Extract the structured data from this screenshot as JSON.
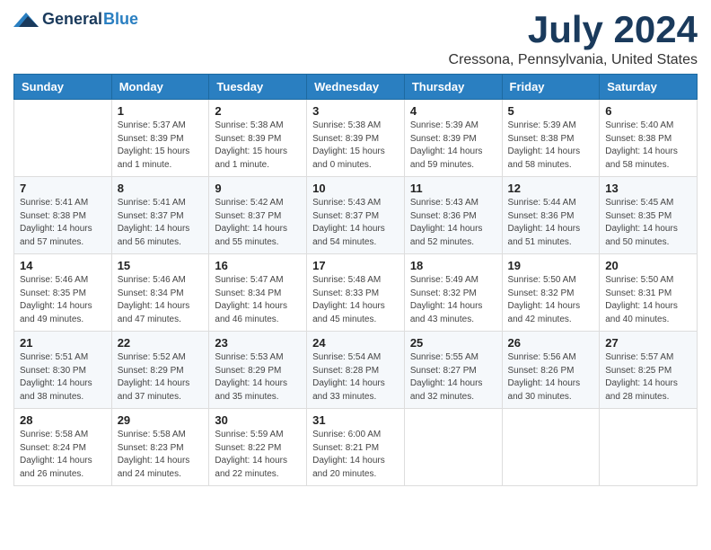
{
  "header": {
    "logo_general": "General",
    "logo_blue": "Blue",
    "month_title": "July 2024",
    "location": "Cressona, Pennsylvania, United States"
  },
  "weekdays": [
    "Sunday",
    "Monday",
    "Tuesday",
    "Wednesday",
    "Thursday",
    "Friday",
    "Saturday"
  ],
  "weeks": [
    [
      {
        "day": "",
        "info": ""
      },
      {
        "day": "1",
        "info": "Sunrise: 5:37 AM\nSunset: 8:39 PM\nDaylight: 15 hours\nand 1 minute."
      },
      {
        "day": "2",
        "info": "Sunrise: 5:38 AM\nSunset: 8:39 PM\nDaylight: 15 hours\nand 1 minute."
      },
      {
        "day": "3",
        "info": "Sunrise: 5:38 AM\nSunset: 8:39 PM\nDaylight: 15 hours\nand 0 minutes."
      },
      {
        "day": "4",
        "info": "Sunrise: 5:39 AM\nSunset: 8:39 PM\nDaylight: 14 hours\nand 59 minutes."
      },
      {
        "day": "5",
        "info": "Sunrise: 5:39 AM\nSunset: 8:38 PM\nDaylight: 14 hours\nand 58 minutes."
      },
      {
        "day": "6",
        "info": "Sunrise: 5:40 AM\nSunset: 8:38 PM\nDaylight: 14 hours\nand 58 minutes."
      }
    ],
    [
      {
        "day": "7",
        "info": "Sunrise: 5:41 AM\nSunset: 8:38 PM\nDaylight: 14 hours\nand 57 minutes."
      },
      {
        "day": "8",
        "info": "Sunrise: 5:41 AM\nSunset: 8:37 PM\nDaylight: 14 hours\nand 56 minutes."
      },
      {
        "day": "9",
        "info": "Sunrise: 5:42 AM\nSunset: 8:37 PM\nDaylight: 14 hours\nand 55 minutes."
      },
      {
        "day": "10",
        "info": "Sunrise: 5:43 AM\nSunset: 8:37 PM\nDaylight: 14 hours\nand 54 minutes."
      },
      {
        "day": "11",
        "info": "Sunrise: 5:43 AM\nSunset: 8:36 PM\nDaylight: 14 hours\nand 52 minutes."
      },
      {
        "day": "12",
        "info": "Sunrise: 5:44 AM\nSunset: 8:36 PM\nDaylight: 14 hours\nand 51 minutes."
      },
      {
        "day": "13",
        "info": "Sunrise: 5:45 AM\nSunset: 8:35 PM\nDaylight: 14 hours\nand 50 minutes."
      }
    ],
    [
      {
        "day": "14",
        "info": "Sunrise: 5:46 AM\nSunset: 8:35 PM\nDaylight: 14 hours\nand 49 minutes."
      },
      {
        "day": "15",
        "info": "Sunrise: 5:46 AM\nSunset: 8:34 PM\nDaylight: 14 hours\nand 47 minutes."
      },
      {
        "day": "16",
        "info": "Sunrise: 5:47 AM\nSunset: 8:34 PM\nDaylight: 14 hours\nand 46 minutes."
      },
      {
        "day": "17",
        "info": "Sunrise: 5:48 AM\nSunset: 8:33 PM\nDaylight: 14 hours\nand 45 minutes."
      },
      {
        "day": "18",
        "info": "Sunrise: 5:49 AM\nSunset: 8:32 PM\nDaylight: 14 hours\nand 43 minutes."
      },
      {
        "day": "19",
        "info": "Sunrise: 5:50 AM\nSunset: 8:32 PM\nDaylight: 14 hours\nand 42 minutes."
      },
      {
        "day": "20",
        "info": "Sunrise: 5:50 AM\nSunset: 8:31 PM\nDaylight: 14 hours\nand 40 minutes."
      }
    ],
    [
      {
        "day": "21",
        "info": "Sunrise: 5:51 AM\nSunset: 8:30 PM\nDaylight: 14 hours\nand 38 minutes."
      },
      {
        "day": "22",
        "info": "Sunrise: 5:52 AM\nSunset: 8:29 PM\nDaylight: 14 hours\nand 37 minutes."
      },
      {
        "day": "23",
        "info": "Sunrise: 5:53 AM\nSunset: 8:29 PM\nDaylight: 14 hours\nand 35 minutes."
      },
      {
        "day": "24",
        "info": "Sunrise: 5:54 AM\nSunset: 8:28 PM\nDaylight: 14 hours\nand 33 minutes."
      },
      {
        "day": "25",
        "info": "Sunrise: 5:55 AM\nSunset: 8:27 PM\nDaylight: 14 hours\nand 32 minutes."
      },
      {
        "day": "26",
        "info": "Sunrise: 5:56 AM\nSunset: 8:26 PM\nDaylight: 14 hours\nand 30 minutes."
      },
      {
        "day": "27",
        "info": "Sunrise: 5:57 AM\nSunset: 8:25 PM\nDaylight: 14 hours\nand 28 minutes."
      }
    ],
    [
      {
        "day": "28",
        "info": "Sunrise: 5:58 AM\nSunset: 8:24 PM\nDaylight: 14 hours\nand 26 minutes."
      },
      {
        "day": "29",
        "info": "Sunrise: 5:58 AM\nSunset: 8:23 PM\nDaylight: 14 hours\nand 24 minutes."
      },
      {
        "day": "30",
        "info": "Sunrise: 5:59 AM\nSunset: 8:22 PM\nDaylight: 14 hours\nand 22 minutes."
      },
      {
        "day": "31",
        "info": "Sunrise: 6:00 AM\nSunset: 8:21 PM\nDaylight: 14 hours\nand 20 minutes."
      },
      {
        "day": "",
        "info": ""
      },
      {
        "day": "",
        "info": ""
      },
      {
        "day": "",
        "info": ""
      }
    ]
  ]
}
